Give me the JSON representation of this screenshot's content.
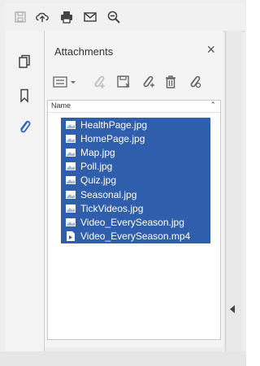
{
  "top_toolbar": {
    "icons": [
      "save-icon",
      "upload-cloud-icon",
      "print-icon",
      "email-icon",
      "zoom-out-icon"
    ]
  },
  "left_rail": {
    "icons": [
      "pages-icon",
      "bookmark-icon",
      "attachment-paperclip-icon"
    ],
    "selected": "attachment-paperclip-icon"
  },
  "attachments_panel": {
    "title": "Attachments",
    "close_label": "×",
    "toolbar_icons": [
      "options-menu-icon",
      "open-attachment-icon",
      "save-attachment-icon",
      "add-attachment-icon",
      "delete-icon",
      "search-attachment-icon"
    ],
    "column_header": "Name",
    "items": [
      {
        "label": "HealthPage.jpg",
        "type": "image"
      },
      {
        "label": "HomePage.jpg",
        "type": "image"
      },
      {
        "label": "Map.jpg",
        "type": "image"
      },
      {
        "label": "Poll.jpg",
        "type": "image"
      },
      {
        "label": "Quiz.jpg",
        "type": "image"
      },
      {
        "label": "Seasonal.jpg",
        "type": "image"
      },
      {
        "label": "TickVideos.jpg",
        "type": "image"
      },
      {
        "label": "Video_EverySeason.jpg",
        "type": "image"
      },
      {
        "label": "Video_EverySeason.mp4",
        "type": "video"
      }
    ]
  },
  "colors": {
    "selection": "#2f5fac",
    "accent_blue": "#2b66c9"
  }
}
